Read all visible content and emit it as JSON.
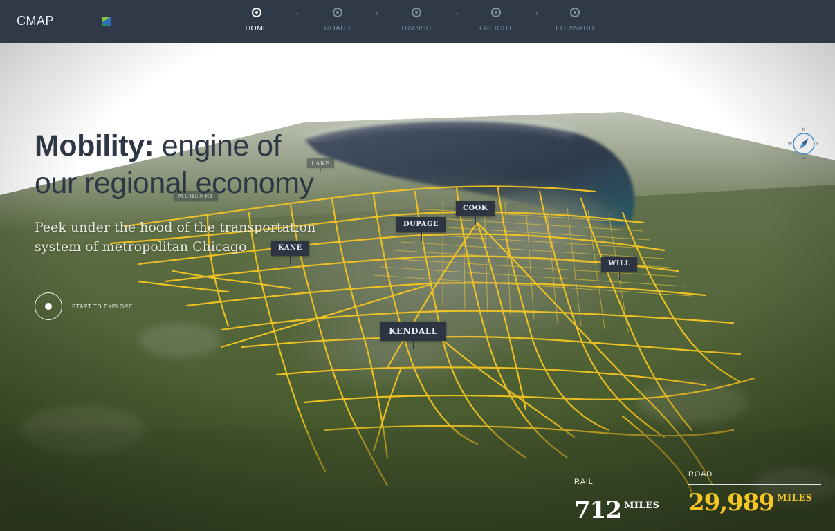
{
  "app": {
    "brand": "CMAP"
  },
  "nav": {
    "steps": [
      {
        "label": "HOME",
        "active": true
      },
      {
        "label": "ROADS",
        "active": false
      },
      {
        "label": "TRANSIT",
        "active": false
      },
      {
        "label": "FREIGHT",
        "active": false
      },
      {
        "label": "FORWARD",
        "active": false
      }
    ],
    "separator": "›"
  },
  "hero": {
    "title_strong": "Mobility:",
    "title_rest_line1": " engine of",
    "title_line2": "our regional economy",
    "subtitle": "Peek under the hood of the transportation system of metropolitan Chicago",
    "cta": "START TO EXPLORE"
  },
  "compass": {
    "n": "N",
    "s": "S",
    "e": "E",
    "w": "W"
  },
  "map": {
    "counties": [
      "KANE",
      "DUPAGE",
      "COOK",
      "WILL",
      "KENDALL",
      "MCHENRY",
      "LAKE"
    ]
  },
  "stats": {
    "rail": {
      "label": "RAIL",
      "value": "712",
      "unit": "MILES"
    },
    "road": {
      "label": "ROAD",
      "value": "29,989",
      "unit": "MILES"
    }
  },
  "colors": {
    "navbar": "#2f3947",
    "title_text": "#2e3745",
    "road_lines": "#f5c623",
    "county_label_bg": "#2d3542",
    "terrain": "#4f6236",
    "lake": "#364454"
  }
}
